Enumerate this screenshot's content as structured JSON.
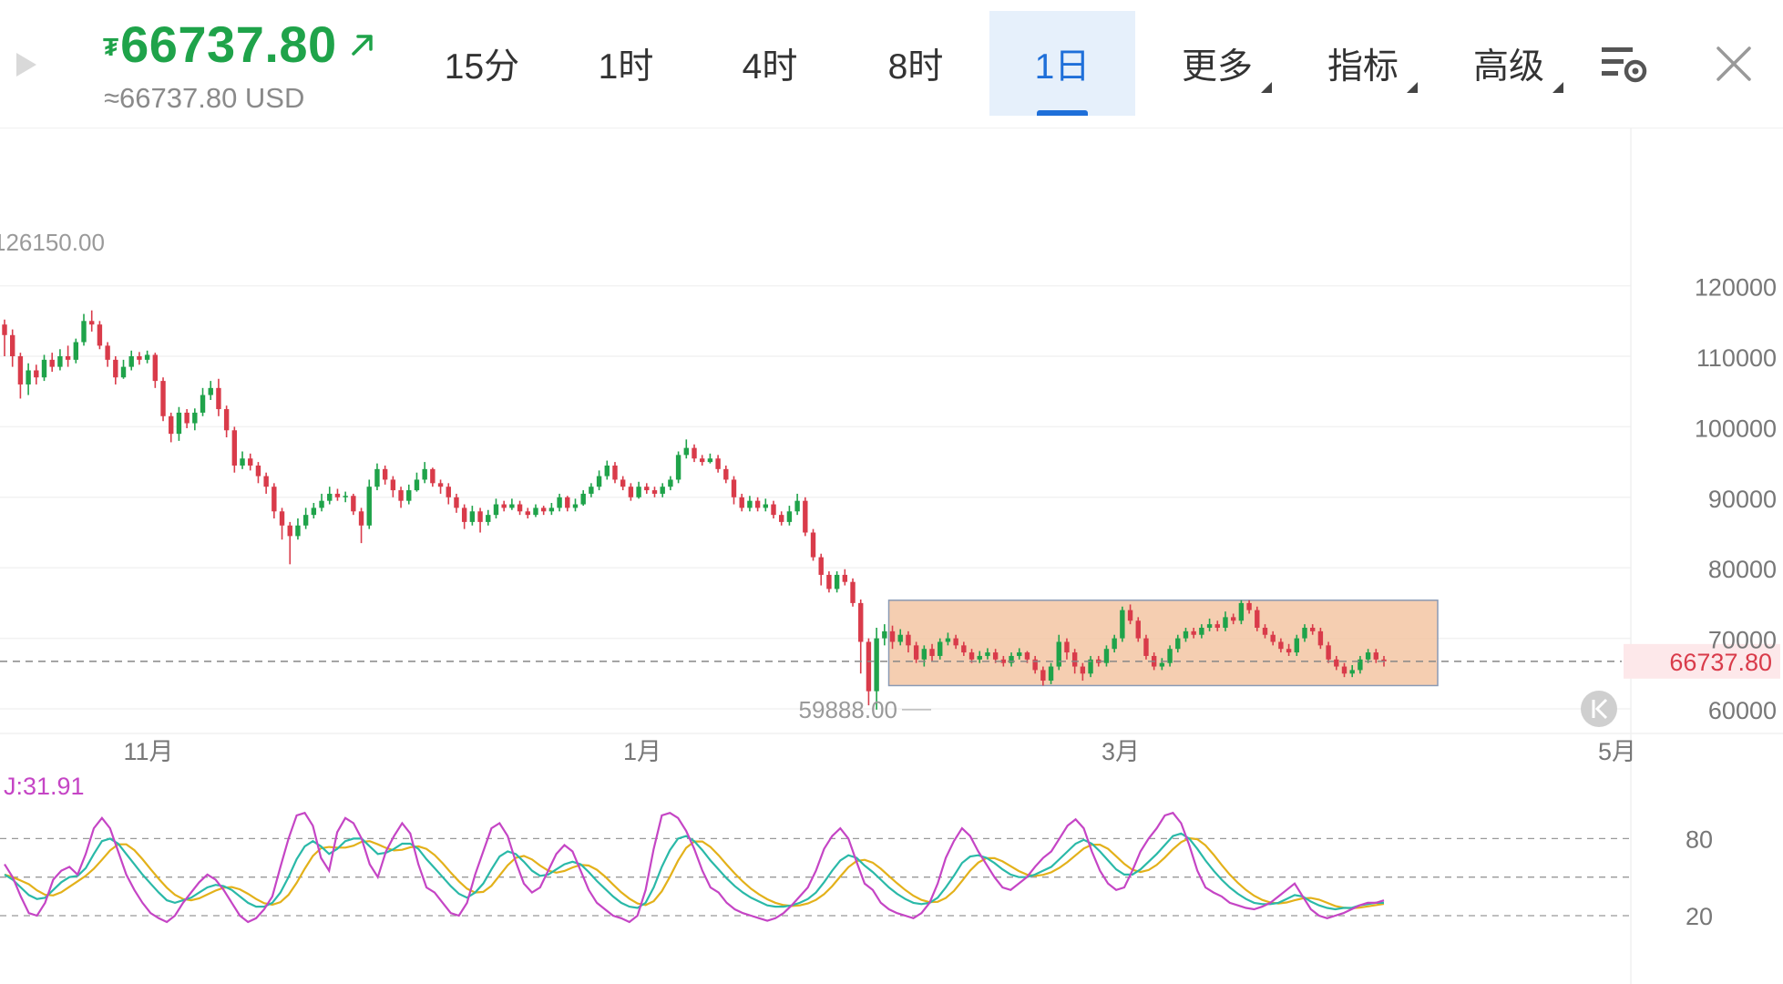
{
  "header": {
    "currency_symbol": "₮",
    "price": "66737.80",
    "price_usd": "≈66737.80 USD",
    "up_color": "#1fa34a",
    "down_color": "#d93b4a"
  },
  "tabs": [
    {
      "label": "15分",
      "active": false,
      "has_dropdown": false
    },
    {
      "label": "1时",
      "active": false,
      "has_dropdown": false
    },
    {
      "label": "4时",
      "active": false,
      "has_dropdown": false
    },
    {
      "label": "8时",
      "active": false,
      "has_dropdown": false
    },
    {
      "label": "1日",
      "active": true,
      "has_dropdown": false
    },
    {
      "label": "更多",
      "active": false,
      "has_dropdown": true
    },
    {
      "label": "指标",
      "active": false,
      "has_dropdown": true
    },
    {
      "label": "高级",
      "active": false,
      "has_dropdown": true
    }
  ],
  "icons": {
    "settings": "chart-settings-icon",
    "close": "close-icon",
    "play": "play-icon",
    "scroll_back": "scroll-to-latest-icon"
  },
  "chart_data": {
    "type": "candlestick",
    "period": "1日",
    "price_axis_ticks": [
      60000,
      70000,
      80000,
      90000,
      100000,
      110000,
      120000
    ],
    "price_axis_labels": [
      "60000",
      "70000",
      "80000",
      "90000",
      "100000",
      "110000",
      "120000"
    ],
    "ylim": [
      57000,
      128000
    ],
    "time_axis_labels": [
      "11月",
      "1月",
      "3月",
      "5月"
    ],
    "current_price": 66737.8,
    "current_price_label": "66737.80",
    "high_marker_label": "126150.00",
    "low_marker_label": "59888.00",
    "highlight_range": {
      "low": 63300,
      "high": 75400
    },
    "candles": [
      [
        114500,
        113000,
        115200,
        110000
      ],
      [
        113000,
        110000,
        113800,
        108500
      ],
      [
        110000,
        106000,
        110500,
        104000
      ],
      [
        106000,
        108000,
        109000,
        104500
      ],
      [
        108000,
        107000,
        108800,
        106000
      ],
      [
        107000,
        109500,
        110200,
        106500
      ],
      [
        109500,
        108500,
        110500,
        107800
      ],
      [
        108500,
        110000,
        111000,
        108000
      ],
      [
        110000,
        109500,
        111500,
        108500
      ],
      [
        109500,
        112000,
        112500,
        109000
      ],
      [
        112000,
        115000,
        116000,
        111500
      ],
      [
        115000,
        114500,
        116500,
        113500
      ],
      [
        114500,
        111500,
        115000,
        111000
      ],
      [
        111500,
        109500,
        112000,
        108500
      ],
      [
        109500,
        107000,
        110000,
        106000
      ],
      [
        107000,
        108500,
        109500,
        106800
      ],
      [
        108500,
        110000,
        110800,
        108000
      ],
      [
        110000,
        109500,
        110600,
        108800
      ],
      [
        109500,
        110200,
        110800,
        109000
      ],
      [
        110200,
        106500,
        110500,
        105500
      ],
      [
        106500,
        101500,
        107000,
        100800
      ],
      [
        101500,
        99000,
        102000,
        97800
      ],
      [
        99000,
        102000,
        102800,
        98000
      ],
      [
        102000,
        100500,
        102500,
        99800
      ],
      [
        100500,
        102000,
        102600,
        99500
      ],
      [
        102000,
        104500,
        105500,
        101500
      ],
      [
        104500,
        105500,
        106500,
        103800
      ],
      [
        105500,
        102500,
        106800,
        101500
      ],
      [
        102500,
        99500,
        103000,
        98500
      ],
      [
        99500,
        94500,
        100000,
        93500
      ],
      [
        94500,
        95500,
        96500,
        94000
      ],
      [
        95500,
        94500,
        96200,
        93800
      ],
      [
        94500,
        93000,
        95000,
        92000
      ],
      [
        93000,
        91500,
        93500,
        90500
      ],
      [
        91500,
        88000,
        92000,
        87000
      ],
      [
        88000,
        86000,
        88500,
        84000
      ],
      [
        86000,
        84500,
        86500,
        80500
      ],
      [
        84500,
        86000,
        87000,
        84000
      ],
      [
        86000,
        87500,
        88500,
        85500
      ],
      [
        87500,
        88500,
        89200,
        87000
      ],
      [
        88500,
        89500,
        90500,
        88000
      ],
      [
        89500,
        90500,
        91500,
        89000
      ],
      [
        90500,
        90000,
        91200,
        89500
      ],
      [
        90000,
        90200,
        90800,
        89300
      ],
      [
        90200,
        88000,
        90500,
        87500
      ],
      [
        88000,
        86000,
        88500,
        83500
      ],
      [
        86000,
        91500,
        92500,
        85500
      ],
      [
        91500,
        94000,
        94800,
        91000
      ],
      [
        94000,
        92500,
        94500,
        91800
      ],
      [
        92500,
        91000,
        93000,
        90000
      ],
      [
        91000,
        89500,
        91500,
        88500
      ],
      [
        89500,
        91000,
        91800,
        89000
      ],
      [
        91000,
        92500,
        93500,
        90800
      ],
      [
        92500,
        94000,
        95000,
        92000
      ],
      [
        94000,
        92000,
        94200,
        91500
      ],
      [
        92000,
        91500,
        92500,
        90500
      ],
      [
        91500,
        90000,
        92000,
        89000
      ],
      [
        90000,
        88500,
        90500,
        87800
      ],
      [
        88500,
        86500,
        89000,
        85500
      ],
      [
        86500,
        88000,
        88800,
        86000
      ],
      [
        88000,
        86500,
        88500,
        85000
      ],
      [
        86500,
        87500,
        88200,
        86000
      ],
      [
        87500,
        89000,
        89800,
        87000
      ],
      [
        89000,
        88500,
        89500,
        88000
      ],
      [
        88500,
        89000,
        89800,
        88200
      ],
      [
        89000,
        88000,
        89500,
        87500
      ],
      [
        88000,
        87500,
        88500,
        87000
      ],
      [
        87500,
        88500,
        89000,
        87200
      ],
      [
        88500,
        88000,
        88800,
        87500
      ],
      [
        88000,
        88500,
        89200,
        87500
      ],
      [
        88500,
        90000,
        90500,
        88000
      ],
      [
        90000,
        88500,
        90200,
        88000
      ],
      [
        88500,
        89000,
        89800,
        88000
      ],
      [
        89000,
        90500,
        91000,
        88800
      ],
      [
        90500,
        91500,
        92000,
        90000
      ],
      [
        91500,
        93000,
        93800,
        91000
      ],
      [
        93000,
        94500,
        95200,
        92500
      ],
      [
        94500,
        92500,
        95000,
        92000
      ],
      [
        92500,
        91500,
        93000,
        91000
      ],
      [
        91500,
        90000,
        92000,
        89500
      ],
      [
        90000,
        91500,
        92200,
        89800
      ],
      [
        91500,
        91000,
        92000,
        90500
      ],
      [
        91000,
        90500,
        91500,
        90000
      ],
      [
        90500,
        91500,
        92000,
        90000
      ],
      [
        91500,
        92500,
        93000,
        91000
      ],
      [
        92500,
        96000,
        96500,
        92000
      ],
      [
        96000,
        97000,
        98200,
        95500
      ],
      [
        97000,
        95500,
        97500,
        95000
      ],
      [
        95500,
        95000,
        96000,
        94500
      ],
      [
        95000,
        95500,
        96200,
        94800
      ],
      [
        95500,
        94000,
        96000,
        93500
      ],
      [
        94000,
        92500,
        94500,
        92000
      ],
      [
        92500,
        90000,
        93000,
        89000
      ],
      [
        90000,
        88500,
        90500,
        88000
      ],
      [
        88500,
        89500,
        90200,
        88000
      ],
      [
        89500,
        88500,
        90000,
        88000
      ],
      [
        88500,
        89000,
        89800,
        88000
      ],
      [
        89000,
        87500,
        89500,
        87000
      ],
      [
        87500,
        86500,
        88000,
        86000
      ],
      [
        86500,
        88000,
        88800,
        86000
      ],
      [
        88000,
        89500,
        90500,
        87500
      ],
      [
        89500,
        85000,
        90000,
        84500
      ],
      [
        85000,
        81500,
        85500,
        81000
      ],
      [
        81500,
        79000,
        82000,
        77500
      ],
      [
        79000,
        77000,
        79500,
        76500
      ],
      [
        77000,
        79000,
        79500,
        76500
      ],
      [
        79000,
        78000,
        79800,
        77500
      ],
      [
        78000,
        75000,
        78500,
        74500
      ],
      [
        75000,
        69500,
        75500,
        65000
      ],
      [
        69500,
        62500,
        70000,
        60500
      ],
      [
        62500,
        70000,
        71500,
        59888
      ],
      [
        70000,
        71000,
        72000,
        69000
      ],
      [
        71000,
        69500,
        71800,
        68500
      ],
      [
        69500,
        70500,
        71300,
        69000
      ],
      [
        70500,
        69000,
        71000,
        68000
      ],
      [
        69000,
        67000,
        69500,
        66500
      ],
      [
        67000,
        68500,
        69000,
        66000
      ],
      [
        68500,
        67500,
        69200,
        66800
      ],
      [
        67500,
        69500,
        70000,
        67000
      ],
      [
        69500,
        70000,
        70800,
        69000
      ],
      [
        70000,
        69000,
        70500,
        68500
      ],
      [
        69000,
        68000,
        69500,
        67500
      ],
      [
        68000,
        67000,
        68500,
        66500
      ],
      [
        67000,
        67500,
        68200,
        66500
      ],
      [
        67500,
        68000,
        68600,
        67000
      ],
      [
        68000,
        67000,
        68500,
        66500
      ],
      [
        67000,
        66500,
        67500,
        66000
      ],
      [
        66500,
        67500,
        68000,
        66000
      ],
      [
        67500,
        68000,
        68600,
        67000
      ],
      [
        68000,
        67000,
        68200,
        66500
      ],
      [
        67000,
        65500,
        67500,
        65000
      ],
      [
        65500,
        64000,
        66000,
        63300
      ],
      [
        64000,
        66000,
        66500,
        63500
      ],
      [
        66000,
        69500,
        70500,
        65500
      ],
      [
        69500,
        68000,
        70000,
        67000
      ],
      [
        68000,
        66000,
        68500,
        65000
      ],
      [
        66000,
        65000,
        66500,
        64000
      ],
      [
        65000,
        67000,
        67500,
        64500
      ],
      [
        67000,
        66500,
        67500,
        66000
      ],
      [
        66500,
        68500,
        69000,
        66000
      ],
      [
        68500,
        70000,
        70500,
        68000
      ],
      [
        70000,
        74000,
        74500,
        69500
      ],
      [
        74000,
        72500,
        74800,
        72000
      ],
      [
        72500,
        70000,
        73000,
        69500
      ],
      [
        70000,
        67500,
        70500,
        67000
      ],
      [
        67500,
        66000,
        68000,
        65500
      ],
      [
        66000,
        66500,
        67200,
        65500
      ],
      [
        66500,
        68500,
        69000,
        66000
      ],
      [
        68500,
        70000,
        70500,
        68000
      ],
      [
        70000,
        71000,
        71500,
        69500
      ],
      [
        71000,
        70500,
        71500,
        70000
      ],
      [
        70500,
        71500,
        72000,
        70000
      ],
      [
        71500,
        72000,
        72800,
        71000
      ],
      [
        72000,
        71500,
        72500,
        71000
      ],
      [
        71500,
        73000,
        73800,
        71000
      ],
      [
        73000,
        72500,
        73500,
        72000
      ],
      [
        72500,
        75000,
        75400,
        72000
      ],
      [
        75000,
        74000,
        75400,
        73500
      ],
      [
        74000,
        71500,
        74500,
        71000
      ],
      [
        71500,
        70500,
        72000,
        70000
      ],
      [
        70500,
        69500,
        71000,
        69000
      ],
      [
        69500,
        68500,
        70000,
        68000
      ],
      [
        68500,
        68000,
        69200,
        67500
      ],
      [
        68000,
        70000,
        70500,
        67500
      ],
      [
        70000,
        71500,
        72000,
        69500
      ],
      [
        71500,
        71000,
        72000,
        70500
      ],
      [
        71000,
        69000,
        71500,
        68500
      ],
      [
        69000,
        67000,
        69500,
        66500
      ],
      [
        67000,
        66000,
        67500,
        65500
      ],
      [
        66000,
        65000,
        66500,
        64500
      ],
      [
        65000,
        65500,
        66200,
        64500
      ],
      [
        65500,
        67000,
        67500,
        65000
      ],
      [
        67000,
        68000,
        68500,
        66500
      ],
      [
        68000,
        67000,
        68500,
        66500
      ],
      [
        67000,
        66737.8,
        67500,
        66000
      ]
    ],
    "kdj": {
      "j_label": "J:31.91",
      "y_ticks": [
        20,
        50,
        80
      ],
      "y_tick_labels": [
        "20",
        "80"
      ],
      "k_color": "#2ab9a8",
      "d_color": "#e3b11a",
      "j_color": "#c545c5",
      "j": [
        60,
        50,
        35,
        22,
        20,
        30,
        48,
        55,
        58,
        52,
        68,
        88,
        96,
        88,
        70,
        52,
        40,
        30,
        22,
        18,
        15,
        20,
        30,
        38,
        46,
        52,
        48,
        40,
        30,
        20,
        15,
        18,
        25,
        35,
        58,
        80,
        98,
        100,
        90,
        65,
        55,
        85,
        96,
        92,
        80,
        60,
        50,
        70,
        82,
        92,
        84,
        60,
        42,
        38,
        30,
        22,
        20,
        30,
        52,
        70,
        88,
        92,
        82,
        62,
        45,
        38,
        42,
        55,
        68,
        75,
        70,
        55,
        40,
        30,
        25,
        20,
        18,
        15,
        20,
        40,
        72,
        98,
        100,
        96,
        86,
        72,
        55,
        42,
        38,
        30,
        25,
        22,
        20,
        18,
        16,
        18,
        22,
        28,
        35,
        42,
        55,
        72,
        82,
        88,
        80,
        62,
        45,
        40,
        30,
        25,
        22,
        20,
        18,
        22,
        30,
        45,
        65,
        78,
        88,
        82,
        70,
        60,
        50,
        42,
        40,
        45,
        50,
        58,
        65,
        70,
        80,
        90,
        95,
        88,
        70,
        55,
        45,
        40,
        42,
        55,
        70,
        80,
        88,
        98,
        100,
        92,
        75,
        55,
        42,
        38,
        35,
        30,
        28,
        26,
        25,
        27,
        30,
        35,
        40,
        45,
        35,
        25,
        20,
        18,
        20,
        22,
        25,
        28,
        30,
        30,
        31.91
      ],
      "k": [
        52,
        48,
        42,
        36,
        33,
        34,
        40,
        46,
        50,
        51,
        57,
        68,
        78,
        80,
        76,
        68,
        60,
        52,
        45,
        38,
        32,
        30,
        32,
        34,
        38,
        42,
        44,
        43,
        40,
        35,
        30,
        27,
        27,
        30,
        38,
        50,
        64,
        74,
        78,
        74,
        68,
        72,
        78,
        80,
        80,
        74,
        68,
        69,
        72,
        76,
        76,
        72,
        64,
        57,
        50,
        43,
        37,
        34,
        38,
        45,
        56,
        66,
        70,
        68,
        62,
        55,
        51,
        52,
        56,
        60,
        62,
        60,
        54,
        47,
        41,
        35,
        30,
        27,
        26,
        30,
        42,
        58,
        71,
        80,
        82,
        78,
        71,
        63,
        56,
        49,
        43,
        38,
        34,
        31,
        28,
        27,
        27,
        28,
        30,
        33,
        38,
        46,
        55,
        63,
        67,
        65,
        59,
        54,
        48,
        42,
        37,
        33,
        30,
        29,
        30,
        34,
        42,
        51,
        61,
        66,
        67,
        65,
        61,
        56,
        52,
        50,
        50,
        52,
        55,
        58,
        64,
        70,
        76,
        79,
        76,
        70,
        63,
        56,
        52,
        52,
        56,
        62,
        68,
        75,
        82,
        84,
        80,
        72,
        63,
        55,
        48,
        42,
        37,
        33,
        30,
        29,
        29,
        30,
        33,
        36,
        35,
        31,
        28,
        26,
        25,
        26,
        26,
        28,
        29,
        30,
        30
      ]
    }
  }
}
